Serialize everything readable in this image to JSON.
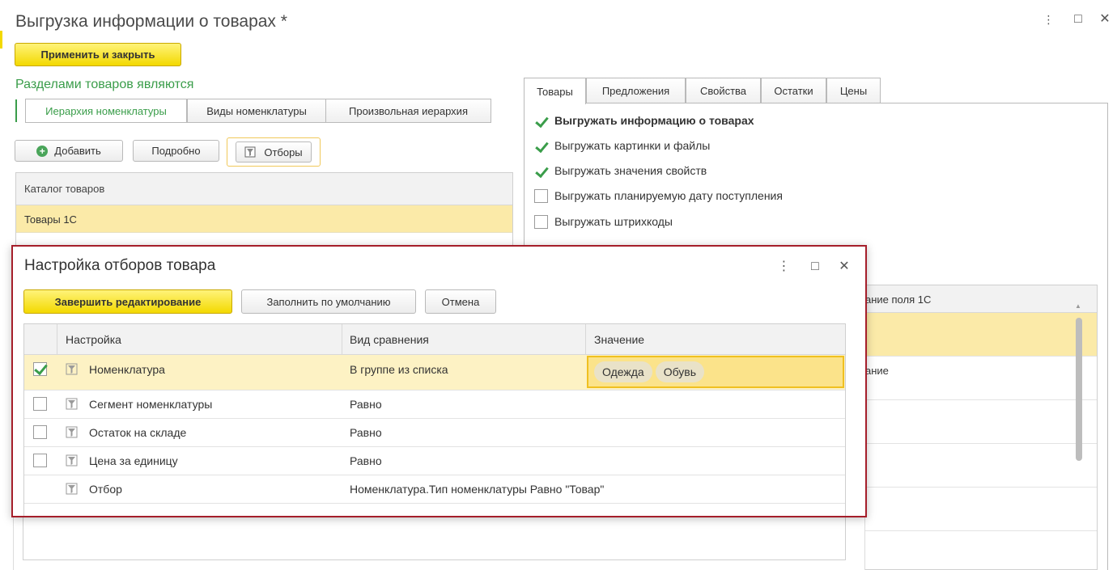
{
  "window": {
    "title": "Выгрузка  информации о товарах *",
    "apply_close_label": "Применить и закрыть"
  },
  "sections": {
    "label": "Разделами товаров являются",
    "tabs": [
      "Иерархия номенклатуры",
      "Виды номенклатуры",
      "Произвольная иерархия"
    ],
    "active_index": 0
  },
  "toolbar": {
    "add_label": "Добавить",
    "details_label": "Подробно",
    "filters_label": "Отборы"
  },
  "catalog": {
    "header": "Каталог товаров",
    "rows": [
      "Товары 1С"
    ]
  },
  "right_tabs": {
    "items": [
      "Товары",
      "Предложения",
      "Свойства",
      "Остатки",
      "Цены"
    ],
    "active_index": 0
  },
  "options": [
    {
      "label": "Выгружать информацию о товарах",
      "checked": true,
      "bold": true
    },
    {
      "label": "Выгружать картинки и файлы",
      "checked": true,
      "bold": false
    },
    {
      "label": "Выгружать значения свойств",
      "checked": true,
      "bold": false
    },
    {
      "label": "Выгружать планируемую дату поступления",
      "checked": false,
      "bold": false
    },
    {
      "label": "Выгружать штрихкоды",
      "checked": false,
      "bold": false
    }
  ],
  "bg_table": {
    "header_fragment": "ание поля 1С",
    "row_fragment": "ание"
  },
  "dialog": {
    "title": "Настройка отборов товара",
    "finish_label": "Завершить редактирование",
    "defaults_label": "Заполнить по умолчанию",
    "cancel_label": "Отмена",
    "columns": [
      "Настройка",
      "Вид сравнения",
      "Значение"
    ],
    "rows": [
      {
        "setting": "Номенклатура",
        "comparison": "В группе из списка",
        "checked": true,
        "values": [
          "Одежда",
          "Обувь"
        ]
      },
      {
        "setting": "Сегмент номенклатуры",
        "comparison": "Равно",
        "checked": false,
        "values": []
      },
      {
        "setting": "Остаток на складе",
        "comparison": "Равно",
        "checked": false,
        "values": []
      },
      {
        "setting": "Цена за единицу",
        "comparison": "Равно",
        "checked": false,
        "values": []
      },
      {
        "setting": "Отбор",
        "comparison": "Номенклатура.Тип номенклатуры Равно \"Товар\"",
        "checked": null,
        "values": []
      }
    ]
  },
  "colors": {
    "accent_green": "#3a9d4a",
    "button_yellow": "#f3d900",
    "selection": "#fbeaa8",
    "dialog_border": "#a51e2a"
  },
  "icons": [
    "more-icon",
    "maximize-icon",
    "close-icon",
    "add-icon",
    "filter-icon",
    "field-icon"
  ]
}
